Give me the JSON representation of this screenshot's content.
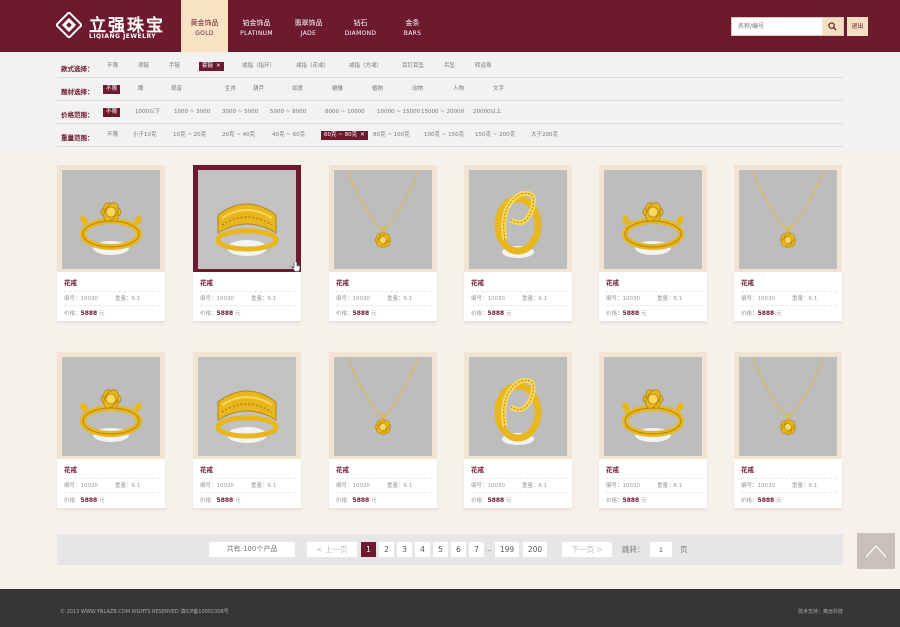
{
  "header": {
    "logo_cn": "立强珠宝",
    "logo_en": "LIQIANG JEWELRY",
    "nav": [
      {
        "cn": "黄金饰品",
        "en": "GOLD",
        "active": true
      },
      {
        "cn": "铂金饰品",
        "en": "PLATINUM",
        "active": false
      },
      {
        "cn": "翡翠饰品",
        "en": "JADE",
        "active": false
      },
      {
        "cn": "钻石",
        "en": "DIAMOND",
        "active": false
      },
      {
        "cn": "金条",
        "en": "BARS",
        "active": false
      }
    ],
    "search_placeholder": "名称/编号",
    "logout_label": "退出"
  },
  "filters": [
    {
      "label": "款式选择：",
      "options": [
        "不限",
        "项链",
        "手链",
        "套链",
        "戒指（指环）",
        "戒指（花戒）",
        "戒指（方戒）",
        "耳钉耳坠",
        "吊坠",
        "转运珠"
      ],
      "selected": 3
    },
    {
      "label": "题材选择：",
      "options": [
        "不限",
        "鹰",
        "观音",
        "生肖",
        "葫芦",
        "如意",
        "貔貅",
        "植物",
        "动物",
        "人物",
        "文字"
      ],
      "selected": 0
    },
    {
      "label": "价格范围：",
      "options": [
        "不限",
        "1000以下",
        "1000 ~ 3000",
        "3000 ~ 5000",
        "5000 ~ 8000",
        "8000 ~ 10000",
        "10000 ~ 15000",
        "15000 ~ 20000",
        "20000以上"
      ],
      "selected": 0
    },
    {
      "label": "重量范围：",
      "options": [
        "不限",
        "小于10克",
        "10克 ~ 20克",
        "20克 ~ 40克",
        "40克 ~ 60克",
        "60克 ~ 80克",
        "80克 ~ 100克",
        "100克 ~ 150克",
        "150克 ~ 200克",
        "大于200克"
      ],
      "selected": 5
    }
  ],
  "product_labels": {
    "code": "编号：",
    "weight": "重量：",
    "price": "价格：",
    "currency": "元"
  },
  "products": [
    {
      "name": "花戒",
      "code": "10030",
      "weight": "6.1",
      "price": "5888",
      "image": "flower-ring-image"
    },
    {
      "name": "花戒",
      "code": "10030",
      "weight": "6.1",
      "price": "5888",
      "image": "band-ring-image"
    },
    {
      "name": "花戒",
      "code": "10030",
      "weight": "6.1",
      "price": "5888",
      "image": "pendant-necklace-image"
    },
    {
      "name": "花戒",
      "code": "10030",
      "weight": "6.1",
      "price": "5888",
      "image": "swirl-ring-image"
    },
    {
      "name": "花戒",
      "code": "10030",
      "weight": "6.1",
      "price": "5888",
      "image": "flower-ring-image"
    },
    {
      "name": "花戒",
      "code": "10030",
      "weight": "6.1",
      "price": "5888",
      "image": "pendant-necklace-image"
    },
    {
      "name": "花戒",
      "code": "10030",
      "weight": "6.1",
      "price": "5888",
      "image": "flower-ring-image"
    },
    {
      "name": "花戒",
      "code": "10030",
      "weight": "6.1",
      "price": "5888",
      "image": "band-ring-image"
    },
    {
      "name": "花戒",
      "code": "10030",
      "weight": "6.1",
      "price": "5888",
      "image": "pendant-necklace-image"
    },
    {
      "name": "花戒",
      "code": "10030",
      "weight": "6.1",
      "price": "5888",
      "image": "swirl-ring-image"
    },
    {
      "name": "花戒",
      "code": "10030",
      "weight": "6.1",
      "price": "5888",
      "image": "flower-ring-image"
    },
    {
      "name": "花戒",
      "code": "10030",
      "weight": "6.1",
      "price": "5888",
      "image": "pendant-necklace-image"
    }
  ],
  "active_product": 1,
  "pagination": {
    "total": "共有:100个产品",
    "prev": "< 上一页",
    "next": "下一页 >",
    "pages": [
      "1",
      "2",
      "3",
      "4",
      "5",
      "6",
      "7"
    ],
    "ellipsis": "...",
    "last_pages": [
      "199",
      "200"
    ],
    "current": "1",
    "jump_label": "跳转：",
    "jump_value": "1",
    "page_suffix": "页"
  },
  "footer": {
    "copyright": "© 2013 WWW.YNLAZB.COM RIGHTS RESERVED    滇ICP备10002308号",
    "tech_support": "技术支持：奥远科技"
  },
  "colors": {
    "brand": "#6d1a2e",
    "gold": "#f7e3c3",
    "background": "#f6f1ea",
    "footer": "#363636"
  }
}
